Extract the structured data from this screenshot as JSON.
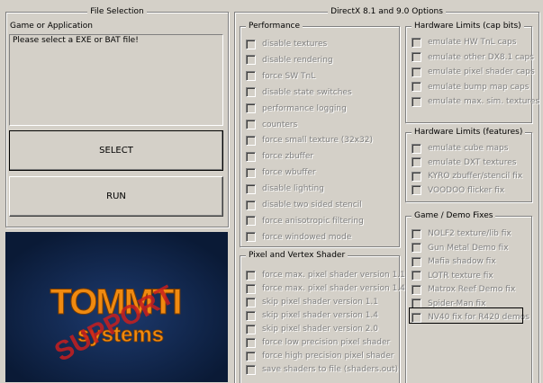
{
  "file_selection": {
    "title": "File Selection",
    "field_label": "Game or Application",
    "field_value": "Please select a EXE or BAT file!",
    "select_button": "SELECT",
    "run_button": "RUN"
  },
  "directx": {
    "title": "DirectX 8.1 and 9.0 Options"
  },
  "performance": {
    "title": "Performance",
    "items": [
      "disable textures",
      "disable rendering",
      "force SW TnL",
      "disable state switches",
      "performance logging",
      "counters",
      "force small texture (32x32)",
      "force zbuffer",
      "force wbuffer",
      "disable lighting",
      "disable two sided stencil",
      "force anisotropic filtering",
      "force windowed mode"
    ]
  },
  "pixel_vertex": {
    "title": "Pixel and Vertex Shader",
    "items": [
      "force max. pixel shader version 1.1",
      "force max. pixel shader version 1.4",
      "skip pixel shader version 1.1",
      "skip pixel shader version 1.4",
      "skip pixel shader version 2.0",
      "force low precision pixel shader",
      "force high precision pixel shader",
      "save shaders to file (shaders.out)"
    ]
  },
  "hw_caps": {
    "title": "Hardware Limits (cap bits)",
    "items": [
      "emulate HW TnL caps",
      "emulate other DX8.1 caps",
      "emulate pixel shader caps",
      "emulate bump map caps",
      "emulate max. sim. textures"
    ]
  },
  "hw_features": {
    "title": "Hardware Limits (features)",
    "items": [
      "emulate cube maps",
      "emulate DXT textures",
      "KYRO zbuffer/stencil fix",
      "VOODOO flicker fix"
    ]
  },
  "game_fixes": {
    "title": "Game / Demo Fixes",
    "items": [
      "NOLF2 texture/lib fix",
      "Gun Metal Demo fix",
      "Mafia shadow fix",
      "LOTR texture fix",
      "Matrox Reef Demo fix",
      "Spider-Man fix",
      "NV40 fix for R420 demos"
    ]
  },
  "logo": {
    "brand": "TOMMTI",
    "sub": "systems",
    "stamp": "SUPPORT",
    "colors": {
      "bg": "#0c1e3e",
      "brand": "#f08a10",
      "stamp": "#c81e1e"
    }
  }
}
